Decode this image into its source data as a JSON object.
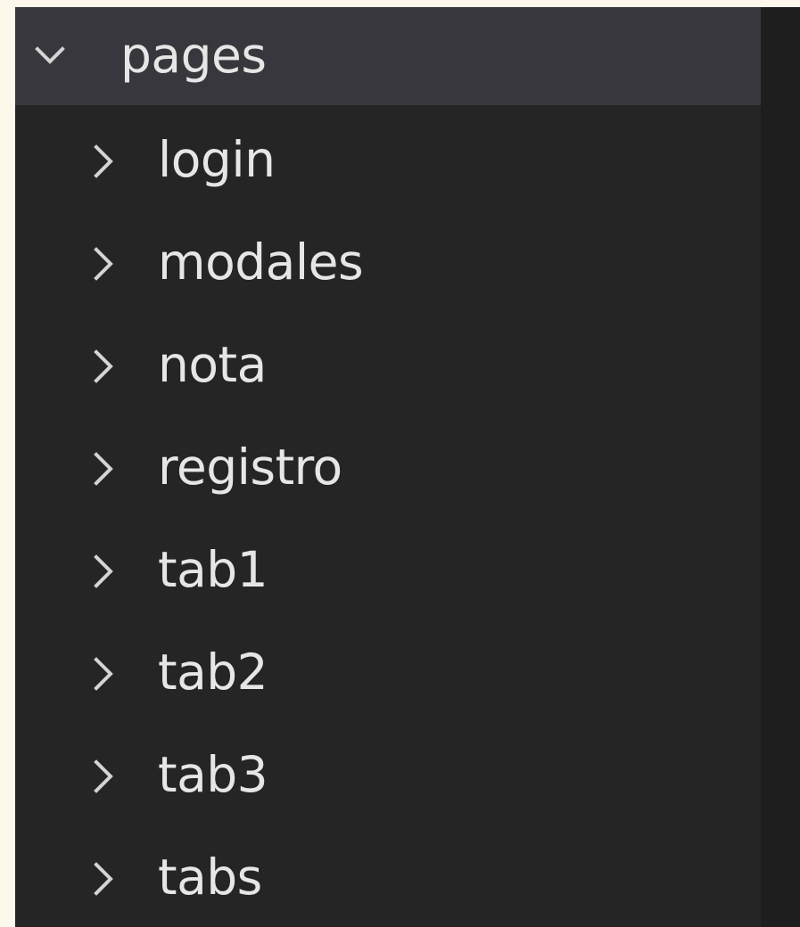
{
  "explorer": {
    "folder": {
      "name": "pages",
      "expanded": true,
      "icon": "chevron-down-icon"
    },
    "items": [
      {
        "label": "login",
        "icon": "chevron-right-icon"
      },
      {
        "label": "modales",
        "icon": "chevron-right-icon"
      },
      {
        "label": "nota",
        "icon": "chevron-right-icon"
      },
      {
        "label": "registro",
        "icon": "chevron-right-icon"
      },
      {
        "label": "tab1",
        "icon": "chevron-right-icon"
      },
      {
        "label": "tab2",
        "icon": "chevron-right-icon"
      },
      {
        "label": "tab3",
        "icon": "chevron-right-icon"
      },
      {
        "label": "tabs",
        "icon": "chevron-right-icon"
      }
    ]
  },
  "colors": {
    "sidebar_bg": "#252526",
    "header_bg": "#37373d",
    "editor_bg": "#1e1e1e",
    "text": "#e6e6e6"
  }
}
